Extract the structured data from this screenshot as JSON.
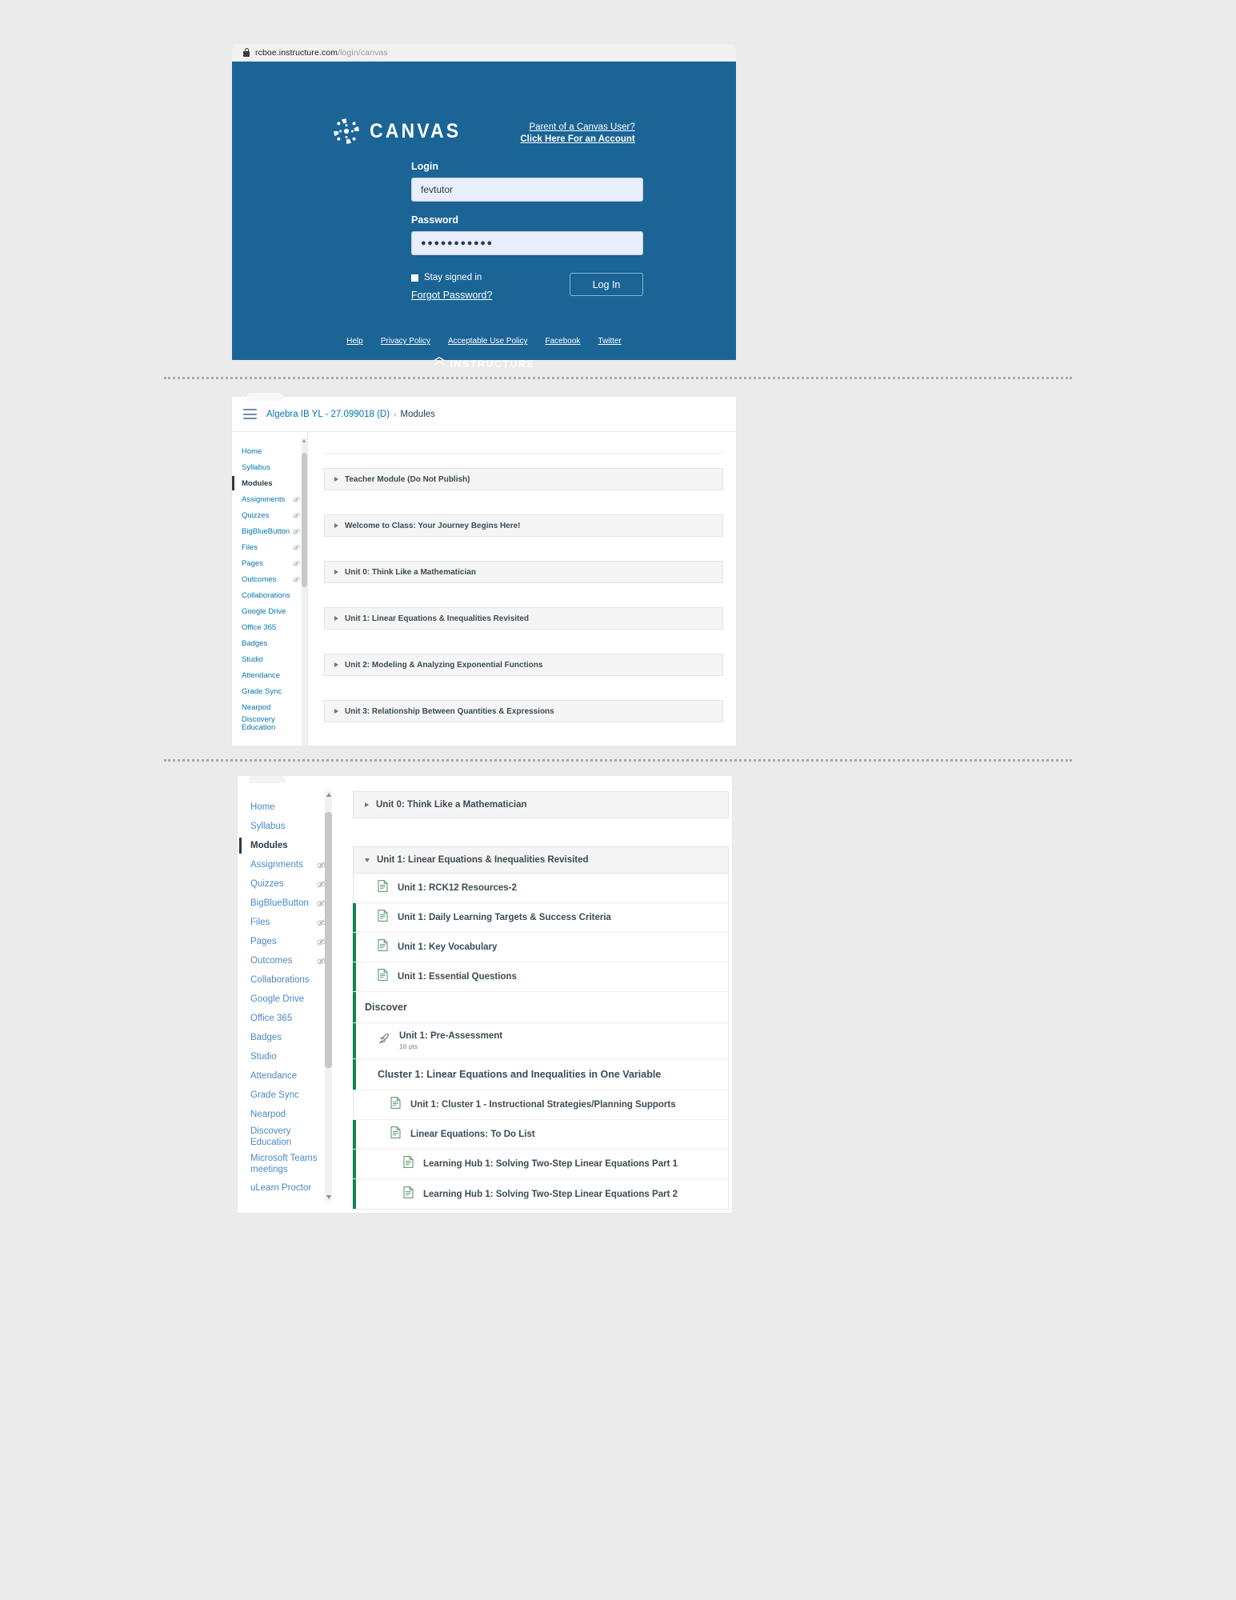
{
  "browser": {
    "url_prefix": "rcboe.instructure.com",
    "url_suffix": "/login/canvas"
  },
  "login": {
    "brand": "CANVAS",
    "parent_link_1": "Parent of a Canvas User?",
    "parent_link_2": "Click Here For an Account",
    "login_label": "Login",
    "login_value": "fevtutor",
    "password_label": "Password",
    "password_value": "●●●●●●●●●●●",
    "stay_signed_in": "Stay signed in",
    "forgot_password": "Forgot Password?",
    "login_button": "Log In",
    "footer_links": [
      "Help",
      "Privacy Policy",
      "Acceptable Use Policy",
      "Facebook",
      "Twitter"
    ],
    "instructure": "INSTRUCTURE",
    "bg_color": "#1a6496"
  },
  "panel2": {
    "breadcrumb_course": "Algebra IB YL - 27.099018 (D)",
    "breadcrumb_sep": "›",
    "breadcrumb_current": "Modules",
    "nav": [
      {
        "label": "Home",
        "hidden": false,
        "active": false
      },
      {
        "label": "Syllabus",
        "hidden": false,
        "active": false
      },
      {
        "label": "Modules",
        "hidden": false,
        "active": true
      },
      {
        "label": "Assignments",
        "hidden": true,
        "active": false
      },
      {
        "label": "Quizzes",
        "hidden": true,
        "active": false
      },
      {
        "label": "BigBlueButton",
        "hidden": true,
        "active": false
      },
      {
        "label": "Files",
        "hidden": true,
        "active": false
      },
      {
        "label": "Pages",
        "hidden": true,
        "active": false
      },
      {
        "label": "Outcomes",
        "hidden": true,
        "active": false
      },
      {
        "label": "Collaborations",
        "hidden": false,
        "active": false
      },
      {
        "label": "Google Drive",
        "hidden": false,
        "active": false
      },
      {
        "label": "Office 365",
        "hidden": false,
        "active": false
      },
      {
        "label": "Badges",
        "hidden": false,
        "active": false
      },
      {
        "label": "Studio",
        "hidden": false,
        "active": false
      },
      {
        "label": "Attendance",
        "hidden": false,
        "active": false
      },
      {
        "label": "Grade Sync",
        "hidden": false,
        "active": false
      },
      {
        "label": "Nearpod",
        "hidden": false,
        "active": false
      },
      {
        "label": "Discovery Education",
        "hidden": false,
        "active": false
      }
    ],
    "modules": [
      "Teacher Module (Do Not Publish)",
      "Welcome to Class: Your Journey Begins Here!",
      "Unit 0: Think Like a Mathematician",
      "Unit 1: Linear Equations & Inequalities Revisited",
      "Unit 2: Modeling & Analyzing Exponential Functions",
      "Unit 3: Relationship Between Quantities & Expressions"
    ]
  },
  "panel3": {
    "nav": [
      {
        "label": "Home",
        "hidden": false,
        "active": false
      },
      {
        "label": "Syllabus",
        "hidden": false,
        "active": false
      },
      {
        "label": "Modules",
        "hidden": false,
        "active": true
      },
      {
        "label": "Assignments",
        "hidden": true,
        "active": false
      },
      {
        "label": "Quizzes",
        "hidden": true,
        "active": false
      },
      {
        "label": "BigBlueButton",
        "hidden": true,
        "active": false
      },
      {
        "label": "Files",
        "hidden": true,
        "active": false
      },
      {
        "label": "Pages",
        "hidden": true,
        "active": false
      },
      {
        "label": "Outcomes",
        "hidden": true,
        "active": false
      },
      {
        "label": "Collaborations",
        "hidden": false,
        "active": false
      },
      {
        "label": "Google Drive",
        "hidden": false,
        "active": false
      },
      {
        "label": "Office 365",
        "hidden": false,
        "active": false
      },
      {
        "label": "Badges",
        "hidden": false,
        "active": false
      },
      {
        "label": "Studio",
        "hidden": false,
        "active": false
      },
      {
        "label": "Attendance",
        "hidden": false,
        "active": false
      },
      {
        "label": "Grade Sync",
        "hidden": false,
        "active": false
      },
      {
        "label": "Nearpod",
        "hidden": false,
        "active": false
      },
      {
        "label": "Discovery Education",
        "hidden": false,
        "active": false
      },
      {
        "label": "Microsoft Teams meetings",
        "hidden": false,
        "active": false
      },
      {
        "label": "uLearn Proctor",
        "hidden": false,
        "active": false
      }
    ],
    "module_collapsed": "Unit 0: Think Like a Mathematician",
    "module_expanded": "Unit 1: Linear Equations & Inequalities Revisited",
    "items": [
      {
        "label": "Unit 1: RCK12 Resources-2",
        "icon": "document-icon",
        "indent": 1,
        "published": false,
        "points": ""
      },
      {
        "label": "Unit 1: Daily Learning Targets & Success Criteria",
        "icon": "document-icon",
        "indent": 1,
        "published": true,
        "points": ""
      },
      {
        "label": "Unit 1: Key Vocabulary",
        "icon": "document-icon",
        "indent": 1,
        "published": true,
        "points": ""
      },
      {
        "label": "Unit 1: Essential Questions",
        "icon": "document-icon",
        "indent": 1,
        "published": true,
        "points": ""
      },
      {
        "label": "Discover",
        "icon": "",
        "indent": 0,
        "published": true,
        "points": ""
      },
      {
        "label": "Unit 1: Pre-Assessment",
        "icon": "rocket-icon",
        "indent": 1,
        "published": true,
        "points": "16 pts"
      },
      {
        "label": "Cluster 1: Linear Equations and Inequalities in One Variable",
        "icon": "",
        "indent": 1,
        "published": true,
        "points": ""
      },
      {
        "label": "Unit 1: Cluster 1 - Instructional Strategies/Planning Supports",
        "icon": "document-icon",
        "indent": 2,
        "published": false,
        "points": ""
      },
      {
        "label": "Linear Equations: To Do List",
        "icon": "document-icon",
        "indent": 2,
        "published": true,
        "points": ""
      },
      {
        "label": "Learning Hub 1: Solving Two-Step Linear Equations Part 1",
        "icon": "document-icon",
        "indent": 3,
        "published": true,
        "points": ""
      },
      {
        "label": "Learning Hub 1: Solving Two-Step Linear Equations Part 2",
        "icon": "document-icon",
        "indent": 3,
        "published": true,
        "points": ""
      }
    ]
  }
}
